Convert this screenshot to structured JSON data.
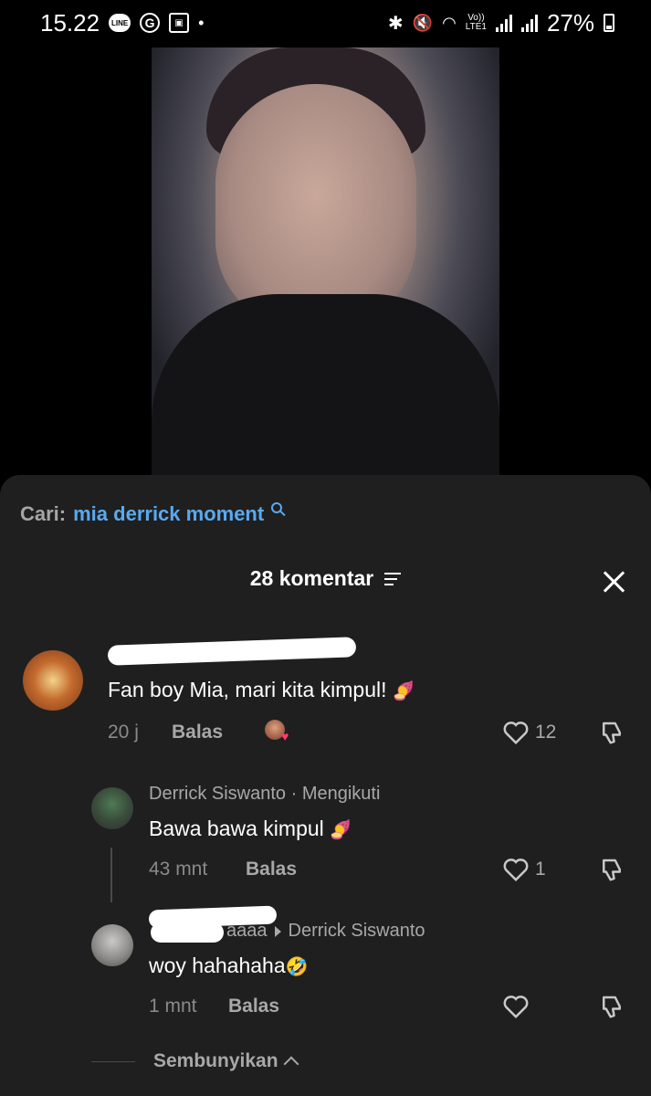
{
  "status_bar": {
    "time": "15.22",
    "line_icon_label": "LINE",
    "g_icon_label": "G",
    "battery": "27%",
    "network": "LTE1",
    "volte": "Vo))"
  },
  "search": {
    "label": "Cari:",
    "query": "mia derrick moment"
  },
  "comments_header": {
    "count_label": "28 komentar"
  },
  "comments": [
    {
      "text": "Fan boy Mia, mari kita kimpul!",
      "emoji": "🍠",
      "time": "20 j",
      "reply_label": "Balas",
      "likes": "12"
    },
    {
      "user": "Derrick Siswanto · Mengikuti",
      "text": "Bawa bawa kimpul",
      "emoji": "🍠",
      "time": "43 mnt",
      "reply_label": "Balas",
      "likes": "1"
    },
    {
      "user_partial": "aaaa",
      "reply_to": "Derrick Siswanto",
      "text": "woy hahahaha",
      "emoji": "🤣",
      "time": "1 mnt",
      "reply_label": "Balas"
    }
  ],
  "hide_label": "Sembunyikan",
  "icons": {
    "search": "search-icon",
    "filter": "filter-icon",
    "close": "close-icon",
    "heart": "heart-icon",
    "dislike": "dislike-icon",
    "chevron_up": "chevron-up-icon"
  },
  "colors": {
    "accent": "#5aa9f0",
    "sheet_bg": "#1f1f1f",
    "muted_text": "#a8a8a8"
  }
}
